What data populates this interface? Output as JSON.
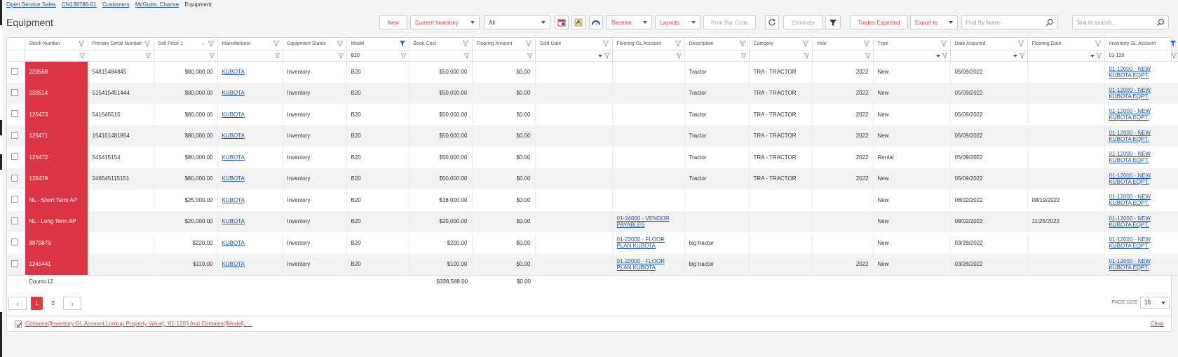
{
  "breadcrumb": [
    "Open Service Sales",
    "CN138786-01",
    "Customers",
    "McGuire, Chanse"
  ],
  "breadcrumb_current": "Equipment",
  "page_title": "Equipment",
  "toolbar": {
    "new": "New",
    "current_inventory": "Current Inventory",
    "all": "All",
    "receive": "Receive",
    "layouts": "Layouts",
    "print_bar_code": "Print Bar Code",
    "eliminate": "Eliminate",
    "trades_expected": "Trades Expected",
    "export_to": "Export to",
    "find_by_notes_placeholder": "Find By Notes",
    "text_search_placeholder": "Text to search..."
  },
  "columns": [
    "Stock Number",
    "Primary Serial Number",
    "Sell Price 1",
    "Manufacturer",
    "Equipment Status",
    "Model",
    "Book Cost",
    "Flooring Amount",
    "Sold Date",
    "Flooring GL Account",
    "Description",
    "Category",
    "Year",
    "Type",
    "Date Acquired",
    "Flooring Date",
    "Inventory GL Account"
  ],
  "filters": {
    "model": "B20",
    "inventory_gl": "01-120"
  },
  "rows": [
    {
      "stock": "220568",
      "serial": "54815484845",
      "price": "$80,000.00",
      "mfr": "KUBOTA",
      "status": "Inventory",
      "model": "B20",
      "cost": "$50,000.00",
      "flooring": "$0.00",
      "sold": "",
      "fgl": "",
      "desc": "Tractor",
      "cat": "TRA - TRACTOR",
      "year": "2022",
      "type": "New",
      "acq": "05/09/2022",
      "fdate": "",
      "igl": "01-12000 - NEW KUBOTA EQPT."
    },
    {
      "stock": "220514",
      "serial": "515415451444",
      "price": "$80,000.00",
      "mfr": "KUBOTA",
      "status": "Inventory",
      "model": "B20",
      "cost": "$50,000.00",
      "flooring": "$0.00",
      "sold": "",
      "fgl": "",
      "desc": "Tractor",
      "cat": "TRA - TRACTOR",
      "year": "2022",
      "type": "New",
      "acq": "05/09/2022",
      "fdate": "",
      "igl": "01-12000 - NEW KUBOTA EQPT."
    },
    {
      "stock": "125473",
      "serial": "541545515",
      "price": "$80,000.00",
      "mfr": "KUBOTA",
      "status": "Inventory",
      "model": "B20",
      "cost": "$50,000.00",
      "flooring": "$0.00",
      "sold": "",
      "fgl": "",
      "desc": "Tractor",
      "cat": "TRA - TRACTOR",
      "year": "2022",
      "type": "New",
      "acq": "05/09/2022",
      "fdate": "",
      "igl": "01-12000 - NEW KUBOTA EQPT."
    },
    {
      "stock": "125471",
      "serial": "154151481854",
      "price": "$80,000.00",
      "mfr": "KUBOTA",
      "status": "Inventory",
      "model": "B20",
      "cost": "$50,000.00",
      "flooring": "$0.00",
      "sold": "",
      "fgl": "",
      "desc": "Tractor",
      "cat": "TRA - TRACTOR",
      "year": "2022",
      "type": "New",
      "acq": "05/09/2022",
      "fdate": "",
      "igl": "01-12000 - NEW KUBOTA EQPT."
    },
    {
      "stock": "125472",
      "serial": "545415154",
      "price": "$80,000.00",
      "mfr": "KUBOTA",
      "status": "Inventory",
      "model": "B20",
      "cost": "$50,000.00",
      "flooring": "$0.00",
      "sold": "",
      "fgl": "",
      "desc": "Tractor",
      "cat": "TRA - TRACTOR",
      "year": "2022",
      "type": "Rental",
      "acq": "05/09/2022",
      "fdate": "",
      "igl": "01-12000 - NEW KUBOTA EQPT."
    },
    {
      "stock": "125479",
      "serial": "246545115151",
      "price": "$80,000.00",
      "mfr": "KUBOTA",
      "status": "Inventory",
      "model": "B20",
      "cost": "$50,000.00",
      "flooring": "$0.00",
      "sold": "",
      "fgl": "",
      "desc": "Tractor",
      "cat": "TRA - TRACTOR",
      "year": "2022",
      "type": "New",
      "acq": "05/09/2022",
      "fdate": "",
      "igl": "01-12000 - NEW KUBOTA EQPT."
    },
    {
      "stock": "NL - Short Term AP",
      "serial": "",
      "price": "$25,000.00",
      "mfr": "KUBOTA",
      "status": "Inventory",
      "model": "B20",
      "cost": "$18,000.00",
      "flooring": "$0.00",
      "sold": "",
      "fgl": "",
      "desc": "",
      "cat": "",
      "year": "",
      "type": "New",
      "acq": "08/02/2022",
      "fdate": "08/19/2022",
      "igl": "01-12000 - NEW KUBOTA EQPT."
    },
    {
      "stock": "NL - Long Term AP",
      "serial": "",
      "price": "$20,000.00",
      "mfr": "KUBOTA",
      "status": "Inventory",
      "model": "B20",
      "cost": "$20,000.00",
      "flooring": "$0.00",
      "sold": "",
      "fgl": "01-24000 - VENDOR PAYABLES",
      "desc": "",
      "cat": "",
      "year": "",
      "type": "New",
      "acq": "08/02/2022",
      "fdate": "11/25/2022",
      "igl": "01-12000 - NEW KUBOTA EQPT."
    },
    {
      "stock": "8879879",
      "serial": "",
      "price": "$220.00",
      "mfr": "KUBOTA",
      "status": "Inventory",
      "model": "B20",
      "cost": "$200.00",
      "flooring": "$0.00",
      "sold": "",
      "fgl": "01-22000 - FLOOR PLAN KUBOTA",
      "desc": "big tractor",
      "cat": "",
      "year": "",
      "type": "New",
      "acq": "03/28/2022",
      "fdate": "",
      "igl": "01-12000 - NEW KUBOTA EQPT."
    },
    {
      "stock": "1245441",
      "serial": "",
      "price": "$110.00",
      "mfr": "KUBOTA",
      "status": "Inventory",
      "model": "B20",
      "cost": "$100.00",
      "flooring": "$0.00",
      "sold": "",
      "fgl": "01-22000 - FLOOR PLAN KUBOTA",
      "desc": "big tractor",
      "cat": "",
      "year": "2022",
      "type": "New",
      "acq": "03/28/2022",
      "fdate": "",
      "igl": "01-12000 - NEW KUBOTA EQPT."
    }
  ],
  "footer": {
    "count": "Count=12",
    "book_cost_total": "$338,588.00",
    "flooring_total": "$0.00"
  },
  "pager": {
    "pages": [
      "1",
      "2"
    ],
    "active": "1",
    "page_size_label": "PAGE SIZE",
    "page_size": "10"
  },
  "filter_expression": "Contains([Inventory GL Account.Lookup Property Value], '01-120') And Contains([Model], '...",
  "clear_label": "Clear",
  "colors": {
    "accent": "#e53935",
    "stock_cell": "#dc3545",
    "link": "#1a56b0"
  }
}
